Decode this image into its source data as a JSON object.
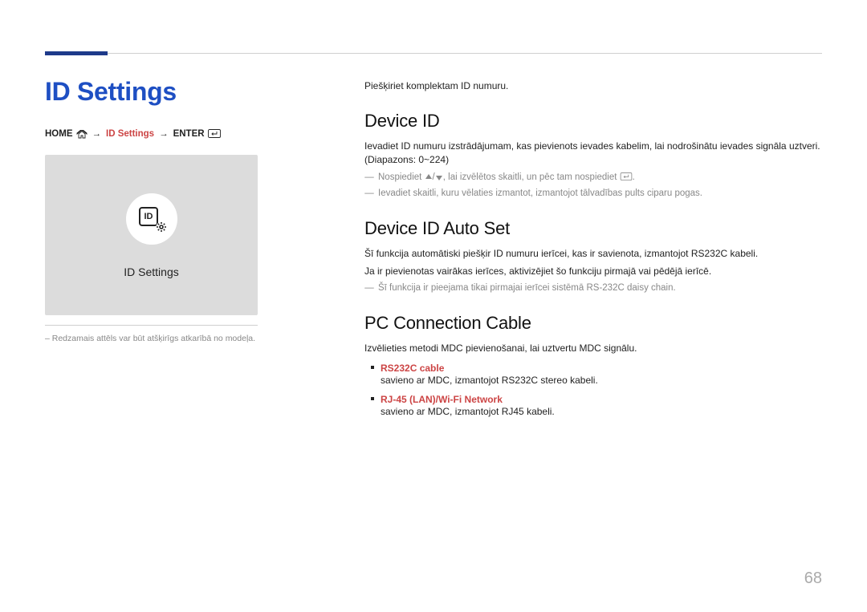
{
  "page_title": "ID Settings",
  "breadcrumb": {
    "home": "HOME",
    "mid": "ID Settings",
    "enter": "ENTER"
  },
  "card": {
    "label": "ID Settings"
  },
  "disclaimer": "– Redzamais attēls var būt atšķirīgs atkarībā no modeļa.",
  "intro": "Piešķiriet komplektam ID numuru.",
  "sections": {
    "device_id": {
      "title": "Device ID",
      "p1": "Ievadiet ID numuru izstrādājumam, kas pievienots ievades kabelim, lai nodrošinātu ievades signāla uztveri. (Diapazons: 0~224)",
      "note1_prefix": "Nospiediet ",
      "note1_suffix": ", lai izvēlētos skaitli, un pēc tam nospiediet ",
      "note1_end": ".",
      "note2": "Ievadiet skaitli, kuru vēlaties izmantot, izmantojot tālvadības pults ciparu pogas."
    },
    "auto_set": {
      "title": "Device ID Auto Set",
      "p1": "Šī funkcija automātiski piešķir ID numuru ierīcei, kas ir savienota, izmantojot RS232C kabeli.",
      "p2": "Ja ir pievienotas vairākas ierīces, aktivizējiet šo funkciju pirmajā vai pēdējā ierīcē.",
      "note1": "Šī funkcija ir pieejama tikai pirmajai ierīcei sistēmā RS-232C daisy chain."
    },
    "pc_cable": {
      "title": "PC Connection Cable",
      "p1": "Izvēlieties metodi MDC pievienošanai, lai uztvertu MDC signālu.",
      "bullets": [
        {
          "title": "RS232C cable",
          "desc": "savieno ar MDC, izmantojot RS232C stereo kabeli."
        },
        {
          "title": "RJ-45 (LAN)/Wi-Fi Network",
          "desc": "savieno ar MDC, izmantojot RJ45 kabeli."
        }
      ]
    }
  },
  "page_number": "68"
}
